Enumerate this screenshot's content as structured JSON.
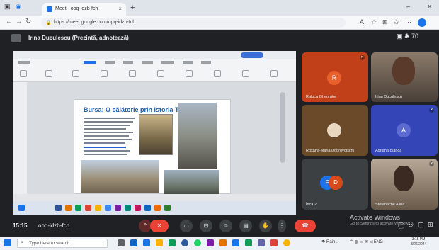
{
  "browser": {
    "tab_title": "Meet - opq-idzb-fch",
    "url": "https://meet.google.com/opq-idzb-fch"
  },
  "meet": {
    "header_title": "Irina Duculescu (Prezintă, adnotează)",
    "time": "15:15",
    "code": "opq-idzb-fch",
    "activate_title": "Activate Windows",
    "activate_sub": "Go to Settings to activate Windows."
  },
  "document": {
    "title": "Bursa: O călătorie prin istoria Turciei"
  },
  "participants": [
    {
      "name": "Raluca Gheorghe",
      "initial": "R",
      "color": "#d84a1b"
    },
    {
      "name": "Irina Duculescu",
      "initial": "",
      "color": "#6a5a50"
    },
    {
      "name": "Roxana-Maria Dobrovolschi",
      "initial": "",
      "color": "#6b4a2a"
    },
    {
      "name": "Adriana Bianca",
      "initial": "A",
      "color": "#3b4cc0"
    },
    {
      "name": "Încă 2",
      "initial": "F D",
      "color": "#3c4043"
    },
    {
      "name": "Stefanache Alina",
      "initial": "",
      "color": "#7a6a5a"
    }
  ],
  "taskbar": {
    "search_placeholder": "Type here to search",
    "weather": "Rain...",
    "clock_time": "3:15 PM",
    "clock_date": "3/26/2024"
  }
}
